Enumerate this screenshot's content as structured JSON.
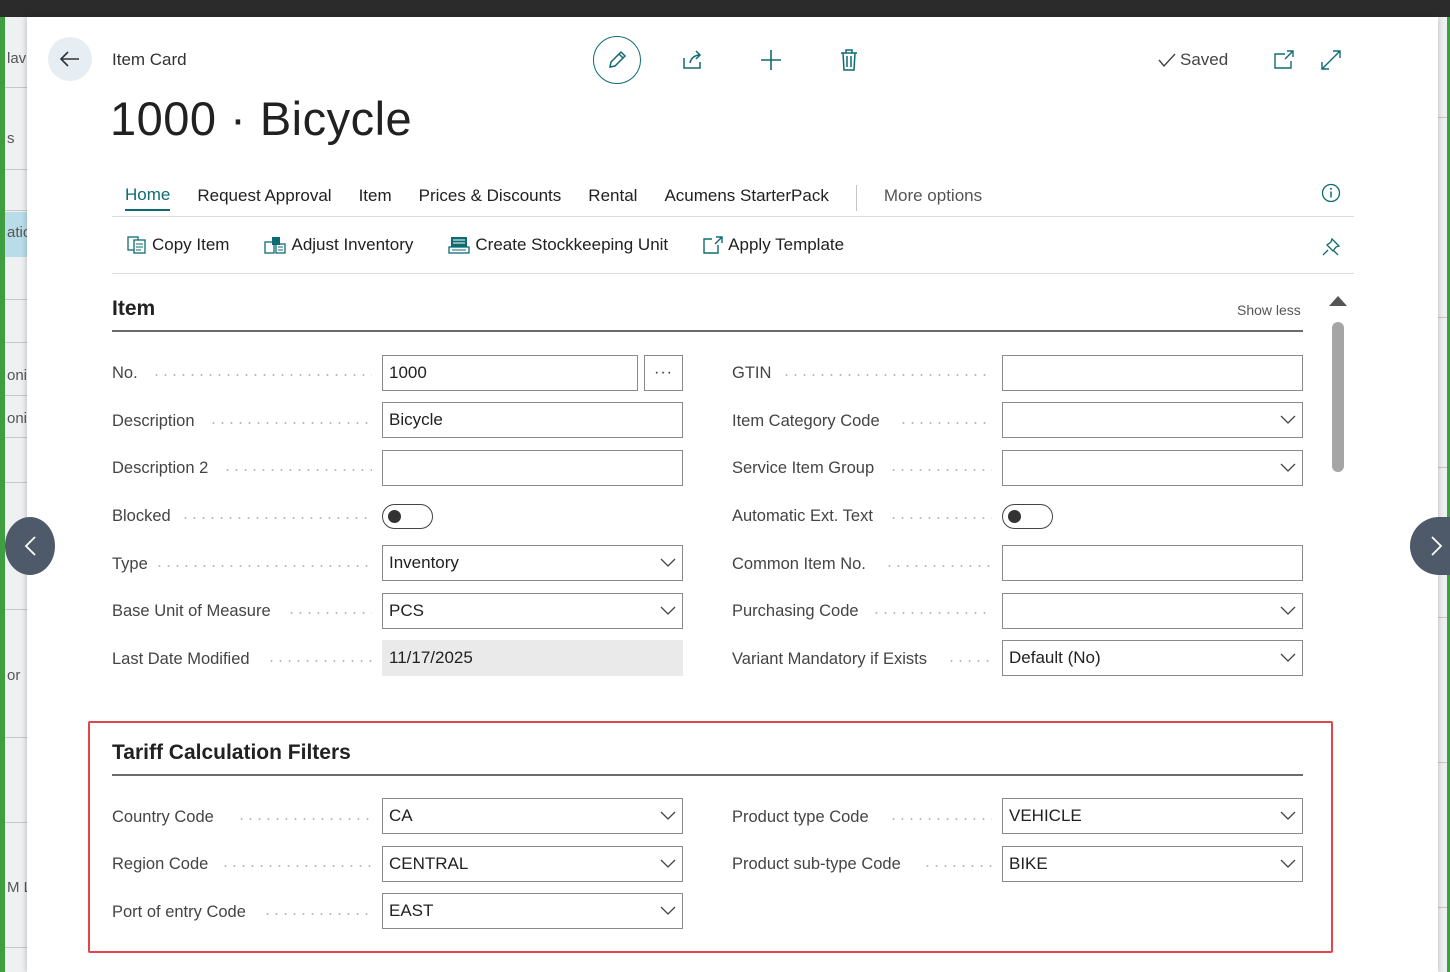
{
  "background": {
    "left_fragments": [
      "lav",
      "s",
      "atio",
      "oni",
      "oni",
      "or",
      "M L"
    ]
  },
  "header": {
    "breadcrumb": "Item Card",
    "title": "1000 · Bicycle",
    "status": "Saved"
  },
  "tabs": [
    {
      "label": "Home",
      "active": true
    },
    {
      "label": "Request Approval"
    },
    {
      "label": "Item"
    },
    {
      "label": "Prices & Discounts"
    },
    {
      "label": "Rental"
    },
    {
      "label": "Acumens StarterPack"
    }
  ],
  "more_options": "More options",
  "actions": [
    "Copy Item",
    "Adjust Inventory",
    "Create Stockkeeping Unit",
    "Apply Template"
  ],
  "item_section": {
    "title": "Item",
    "show_less": "Show less",
    "left": {
      "no": {
        "label": "No.",
        "value": "1000"
      },
      "description": {
        "label": "Description",
        "value": "Bicycle"
      },
      "description2": {
        "label": "Description 2",
        "value": ""
      },
      "blocked": {
        "label": "Blocked",
        "value": false
      },
      "type": {
        "label": "Type",
        "value": "Inventory"
      },
      "base_uom": {
        "label": "Base Unit of Measure",
        "value": "PCS"
      },
      "last_modified": {
        "label": "Last Date Modified",
        "value": "11/17/2025"
      }
    },
    "right": {
      "gtin": {
        "label": "GTIN",
        "value": ""
      },
      "item_category": {
        "label": "Item Category Code",
        "value": ""
      },
      "service_item_group": {
        "label": "Service Item Group",
        "value": ""
      },
      "auto_ext_text": {
        "label": "Automatic Ext. Text",
        "value": false
      },
      "common_item_no": {
        "label": "Common Item No.",
        "value": ""
      },
      "purchasing_code": {
        "label": "Purchasing Code",
        "value": ""
      },
      "variant_mandatory": {
        "label": "Variant Mandatory if Exists",
        "value": "Default (No)"
      }
    }
  },
  "tariff_section": {
    "title": "Tariff Calculation Filters",
    "country": {
      "label": "Country Code",
      "value": "CA"
    },
    "region": {
      "label": "Region Code",
      "value": "CENTRAL"
    },
    "port": {
      "label": "Port of entry Code",
      "value": "EAST"
    },
    "product_type": {
      "label": "Product type Code",
      "value": "VEHICLE"
    },
    "product_subtype": {
      "label": "Product sub-type Code",
      "value": "BIKE"
    }
  },
  "colors": {
    "accent": "#0e6b72",
    "highlight_border": "#e0464c",
    "nav_button": "#4e5a69"
  }
}
